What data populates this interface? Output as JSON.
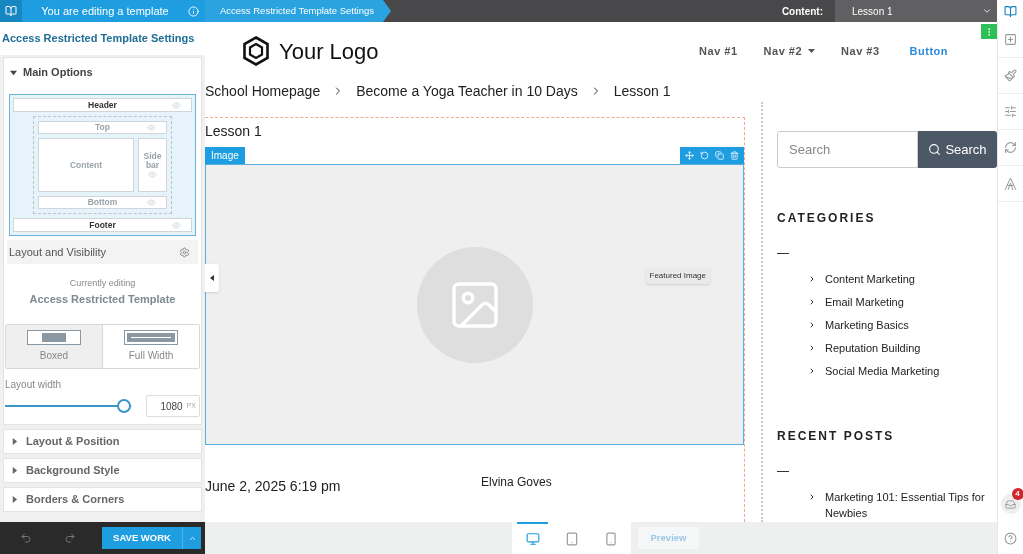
{
  "top_bar": {
    "notice": "You are editing a template",
    "breadcrumb": "Access Restricted Template Settings",
    "content_label": "Content:",
    "content_value": "Lesson 1"
  },
  "settings_panel": {
    "title": "Access Restricted Template Settings",
    "main_options": {
      "label": "Main Options",
      "expanded": true
    },
    "layout_map": {
      "header": "Header",
      "top": "Top",
      "content": "Content",
      "sidebar": "Side bar",
      "bottom": "Bottom",
      "footer": "Footer"
    },
    "layout_visibility": "Layout and Visibility",
    "currently_editing_label": "Currently editing",
    "currently_editing": "Access Restricted Template",
    "layout_types": [
      {
        "label": "Boxed",
        "kind": "boxed",
        "selected": true
      },
      {
        "label": "Full Width",
        "kind": "full",
        "selected": false
      }
    ],
    "layout_width": {
      "label": "Layout width",
      "level": 0.94,
      "value": "1080",
      "unit": "PX"
    },
    "sections": [
      {
        "label": "Layout & Position",
        "expanded": false
      },
      {
        "label": "Background Style",
        "expanded": false
      },
      {
        "label": "Borders & Corners",
        "expanded": false
      }
    ]
  },
  "save_bar": {
    "save": "SAVE WORK"
  },
  "page": {
    "logo": "Your Logo",
    "nav": [
      {
        "label": "Nav #1",
        "kind": "link"
      },
      {
        "label": "Nav #2",
        "kind": "dropdown"
      },
      {
        "label": "Nav #3",
        "kind": "link"
      },
      {
        "label": "Button",
        "kind": "button"
      }
    ],
    "breadcrumbs": [
      "School Homepage",
      "Become a Yoga Teacher in 10 Days",
      "Lesson 1"
    ],
    "lesson_title": "Lesson 1",
    "image_block": {
      "tag": "Image",
      "tooltip": "Featured Image"
    },
    "date": "June 2, 2025 6:19 pm",
    "author": "Elvina Goves",
    "sidebar": {
      "search_placeholder": "Search",
      "search_button": "Search",
      "widgets": [
        {
          "title": "CATEGORIES",
          "items": [
            "Content Marketing",
            "Email Marketing",
            "Marketing Basics",
            "Reputation Building",
            "Social Media Marketing"
          ]
        },
        {
          "title": "RECENT POSTS",
          "items": [
            "Marketing 101: Essential Tips for Newbies"
          ]
        }
      ]
    }
  },
  "devices": [
    {
      "kind": "desktop",
      "selected": true
    },
    {
      "kind": "tablet",
      "selected": false
    },
    {
      "kind": "mobile",
      "selected": false
    }
  ],
  "preview": "Preview",
  "rail": {
    "badge": "4"
  }
}
